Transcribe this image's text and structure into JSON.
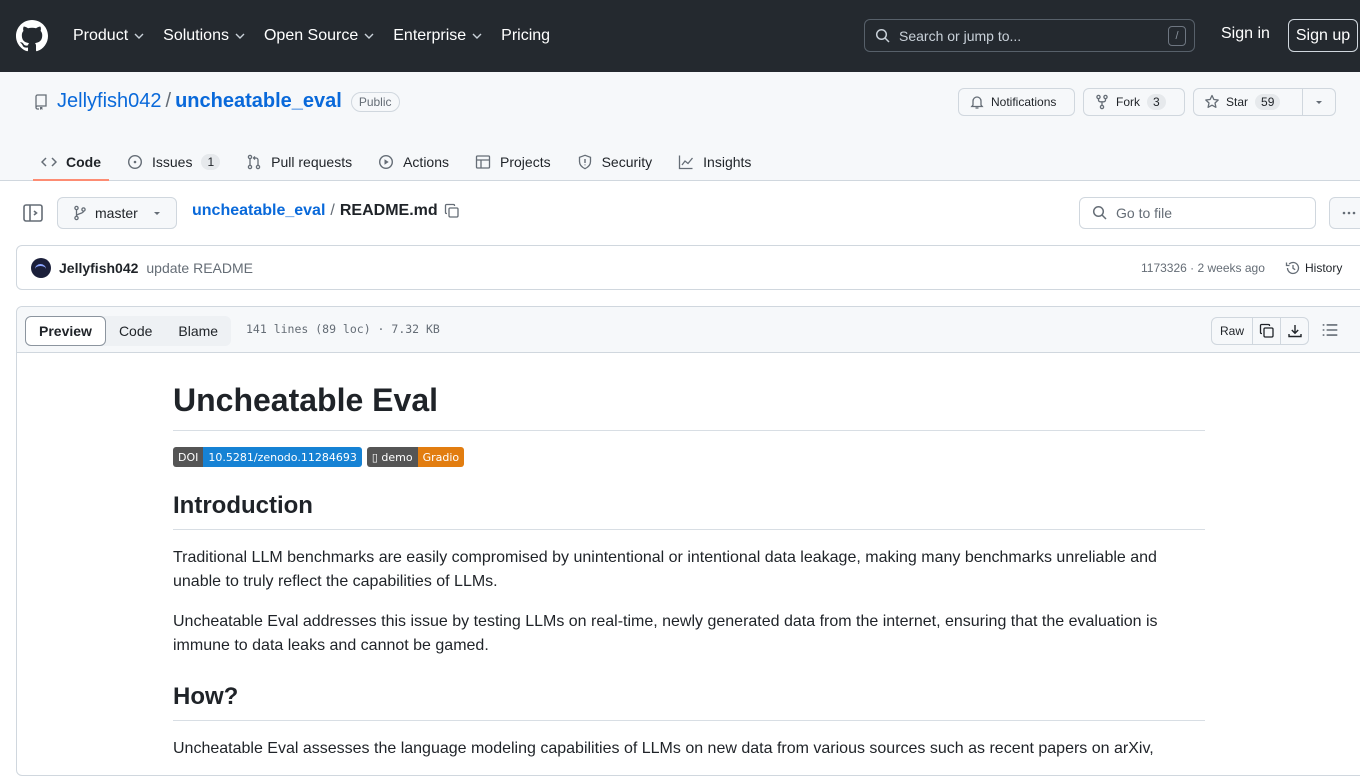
{
  "header": {
    "nav": [
      "Product",
      "Solutions",
      "Open Source",
      "Enterprise",
      "Pricing"
    ],
    "search_placeholder": "Search or jump to...",
    "search_shortcut": "/",
    "sign_in": "Sign in",
    "sign_up": "Sign up"
  },
  "repo": {
    "owner": "Jellyfish042",
    "separator": "/",
    "name": "uncheatable_eval",
    "visibility": "Public",
    "notifications_label": "Notifications",
    "fork_label": "Fork",
    "fork_count": "3",
    "star_label": "Star",
    "star_count": "59",
    "tabs": [
      {
        "label": "Code",
        "icon": "code-icon"
      },
      {
        "label": "Issues",
        "icon": "issue-icon",
        "count": "1"
      },
      {
        "label": "Pull requests",
        "icon": "pull-request-icon"
      },
      {
        "label": "Actions",
        "icon": "play-icon"
      },
      {
        "label": "Projects",
        "icon": "table-icon"
      },
      {
        "label": "Security",
        "icon": "shield-icon"
      },
      {
        "label": "Insights",
        "icon": "graph-icon"
      }
    ]
  },
  "filenav": {
    "branch": "master",
    "path_repo": "uncheatable_eval",
    "path_sep": "/",
    "path_file": "README.md",
    "goto_placeholder": "Go to file"
  },
  "commit": {
    "author": "Jellyfish042",
    "message": "update README",
    "meta": "1173326 · 2 weeks ago",
    "history": "History"
  },
  "file": {
    "tabs": [
      "Preview",
      "Code",
      "Blame"
    ],
    "info": "141 lines (89 loc) · 7.32 KB",
    "raw": "Raw"
  },
  "readme": {
    "title": "Uncheatable Eval",
    "badge_doi_left": "DOI",
    "badge_doi_right": "10.5281/zenodo.11284693",
    "badge_demo_left": "▯ demo",
    "badge_demo_right": "Gradio",
    "h_intro": "Introduction",
    "p1": "Traditional LLM benchmarks are easily compromised by unintentional or intentional data leakage, making many benchmarks unreliable and unable to truly reflect the capabilities of LLMs.",
    "p2": "Uncheatable Eval addresses this issue by testing LLMs on real-time, newly generated data from the internet, ensuring that the evaluation is immune to data leaks and cannot be gamed.",
    "h_how": "How?",
    "p3": "Uncheatable Eval assesses the language modeling capabilities of LLMs on new data from various sources such as recent papers on arXiv,"
  }
}
